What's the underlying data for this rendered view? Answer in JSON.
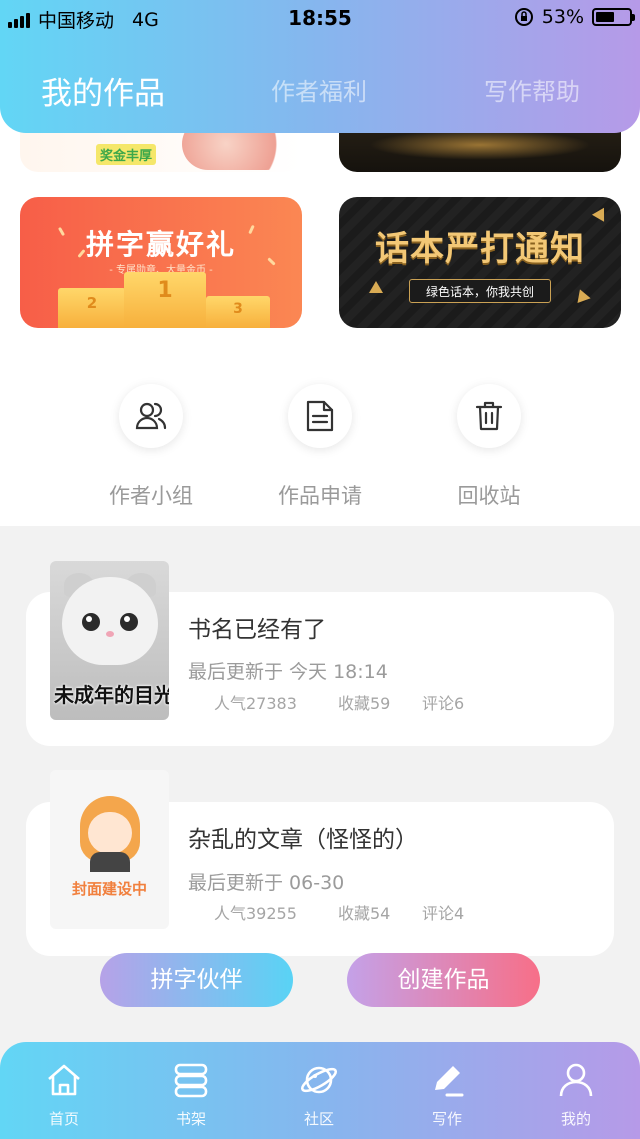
{
  "status_bar": {
    "carrier": "中国移动",
    "network": "4G",
    "time": "18:55",
    "battery": "53%"
  },
  "tabs": [
    {
      "label": "我的作品",
      "active": true
    },
    {
      "label": "作者福利",
      "active": false
    },
    {
      "label": "写作帮助",
      "active": false
    }
  ],
  "banners": {
    "banner1_text": "奖金丰厚",
    "banner3_title": "拼字赢好礼",
    "banner3_subtitle": "- 专属勋章、大量金币 -",
    "banner3_ranks": [
      "2",
      "1",
      "3"
    ],
    "banner4_title": "话本严打通知",
    "banner4_subtitle": "绿色话本，你我共创"
  },
  "actions": [
    {
      "label": "作者小组",
      "icon": "people-icon"
    },
    {
      "label": "作品申请",
      "icon": "document-icon"
    },
    {
      "label": "回收站",
      "icon": "trash-icon"
    }
  ],
  "works": [
    {
      "title": "书名已经有了",
      "updated": "最后更新于 今天 18:14",
      "popularity": "人气27383",
      "favorites": "收藏59",
      "comments": "评论6",
      "cover_caption": "未成年的目光"
    },
    {
      "title": "杂乱的文章（怪怪的）",
      "updated": "最后更新于 06-30",
      "popularity": "人气39255",
      "favorites": "收藏54",
      "comments": "评论4",
      "cover_caption": "封面建设中"
    }
  ],
  "buttons": {
    "partner": "拼字伙伴",
    "create": "创建作品"
  },
  "bottom_nav": [
    {
      "label": "首页",
      "icon": "home-icon"
    },
    {
      "label": "书架",
      "icon": "bookshelf-icon"
    },
    {
      "label": "社区",
      "icon": "planet-icon"
    },
    {
      "label": "写作",
      "icon": "pen-icon",
      "active": true
    },
    {
      "label": "我的",
      "icon": "profile-icon"
    }
  ],
  "colors": {
    "gradient_start": "#62d6f5",
    "gradient_end": "#b69ae8",
    "create_button_end": "#f76f88"
  }
}
